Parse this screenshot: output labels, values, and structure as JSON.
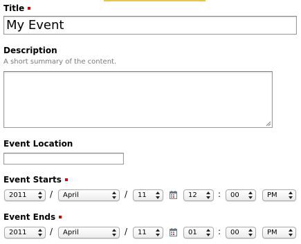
{
  "title_field": {
    "label": "Title",
    "value": "My Event"
  },
  "description_field": {
    "label": "Description",
    "help": "A short summary of the content.",
    "value": ""
  },
  "location_field": {
    "label": "Event Location",
    "value": ""
  },
  "event_starts": {
    "label": "Event Starts",
    "year": "2011",
    "month": "April",
    "day": "11",
    "hour": "12",
    "minute": "00",
    "ampm": "PM"
  },
  "event_ends": {
    "label": "Event Ends",
    "year": "2011",
    "month": "April",
    "day": "11",
    "hour": "01",
    "minute": "00",
    "ampm": "PM"
  },
  "separators": {
    "date": "/",
    "time": ":"
  },
  "icons": {
    "required": "required-marker-icon",
    "calendar": "calendar-icon",
    "select_arrows": "select-arrows-icon",
    "resize": "resize-grip-icon"
  },
  "colors": {
    "required_marker": "#cc0000",
    "help_text": "#76797c",
    "top_accent": "#e8c544"
  }
}
